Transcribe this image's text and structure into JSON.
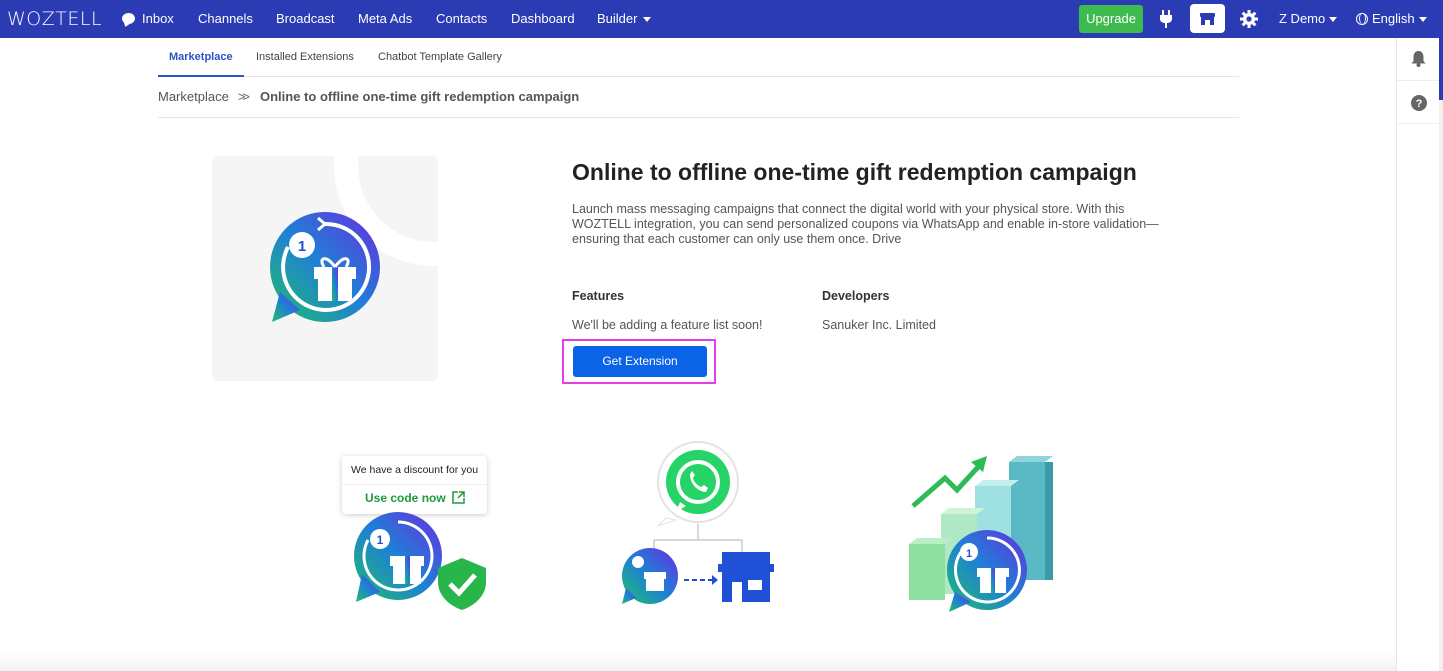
{
  "brand": {
    "logo_text": "WOZTELL",
    "nav_bg": "#2b3bb3",
    "accent": "#0b63e5",
    "success": "#3dbb4f"
  },
  "topnav": {
    "items": [
      {
        "label": "Inbox",
        "icon": "chat-bubble-icon"
      },
      {
        "label": "Channels"
      },
      {
        "label": "Broadcast"
      },
      {
        "label": "Meta Ads"
      },
      {
        "label": "Contacts"
      },
      {
        "label": "Dashboard"
      },
      {
        "label": "Builder",
        "dropdown": true
      }
    ],
    "upgrade_label": "Upgrade",
    "user_label": "Z Demo",
    "language_label": "English",
    "icons": [
      "plug-icon",
      "store-icon",
      "gear-icon",
      "globe-icon"
    ]
  },
  "side_rail": {
    "icons": [
      "bell-icon",
      "help-icon"
    ]
  },
  "subtabs": [
    {
      "label": "Marketplace",
      "active": true
    },
    {
      "label": "Installed Extensions",
      "active": false
    },
    {
      "label": "Chatbot Template Gallery",
      "active": false
    }
  ],
  "breadcrumb": {
    "root": "Marketplace",
    "separator": "»",
    "current": "Online to offline one-time gift redemption campaign"
  },
  "extension": {
    "title": "Online to offline one-time gift redemption campaign",
    "description": "Launch mass messaging campaigns that connect the digital world with your physical store. With this WOZTELL integration, you can send personalized coupons via WhatsApp and enable in-store validation—ensuring that each customer can only use them once. Drive",
    "features_heading": "Features",
    "features_text": "We'll be adding a feature list soon!",
    "developers_heading": "Developers",
    "developers_text": "Sanuker Inc. Limited",
    "cta_label": "Get Extension"
  },
  "illustrations": {
    "coupon_card": {
      "message": "We have a discount for you",
      "link_label": "Use code now"
    }
  }
}
